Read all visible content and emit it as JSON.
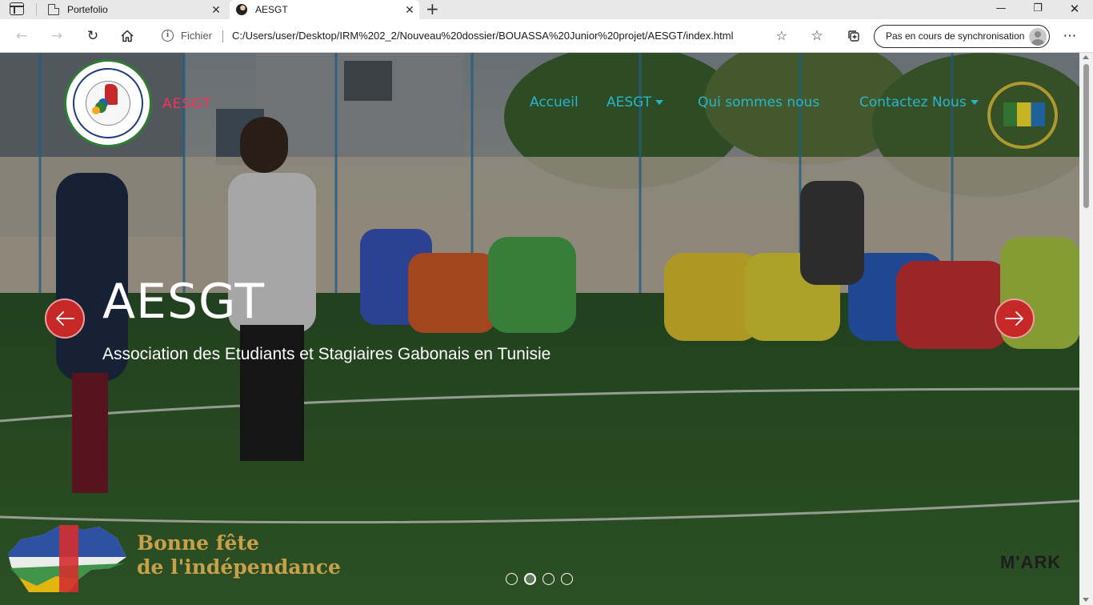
{
  "browser": {
    "tabs": [
      {
        "title": "Portefolio",
        "active": false
      },
      {
        "title": "AESGT",
        "active": true
      }
    ],
    "address": {
      "scheme_label": "Fichier",
      "url": "C:/Users/user/Desktop/IRM%202_2/Nouveau%20dossier/BOUASSA%20Junior%20projet/AESGT/index.html"
    },
    "sync_label": "Pas en cours de synchronisation",
    "icons": {
      "tab-actions": "tab-actions-icon",
      "back": "back-arrow-icon",
      "forward": "forward-arrow-icon",
      "refresh": "refresh-icon",
      "home": "home-icon",
      "favorites": "star-icon",
      "collections": "collections-icon",
      "more": "ellipsis-icon"
    }
  },
  "site": {
    "brand": "AESGT",
    "nav": [
      {
        "label": "Accueil",
        "dropdown": false
      },
      {
        "label": "AESGT",
        "dropdown": true
      },
      {
        "label": "Qui sommes nous",
        "dropdown": false
      },
      {
        "label": "Contactez Nous",
        "dropdown": true
      }
    ],
    "carousel": {
      "title": "AESGT",
      "subtitle": "Association des Etudiants et Stagiaires Gabonais en Tunisie",
      "slides_count": 4,
      "active_index": 1
    },
    "banner": {
      "line1": "Bonne fête",
      "line2": "de l'indépendance"
    },
    "watermark": "M'ARK",
    "colors": {
      "brand": "#ff2f5a",
      "nav": "#27b6c9",
      "arrow": "#c62828",
      "banner_text": "#c8a04a"
    }
  }
}
